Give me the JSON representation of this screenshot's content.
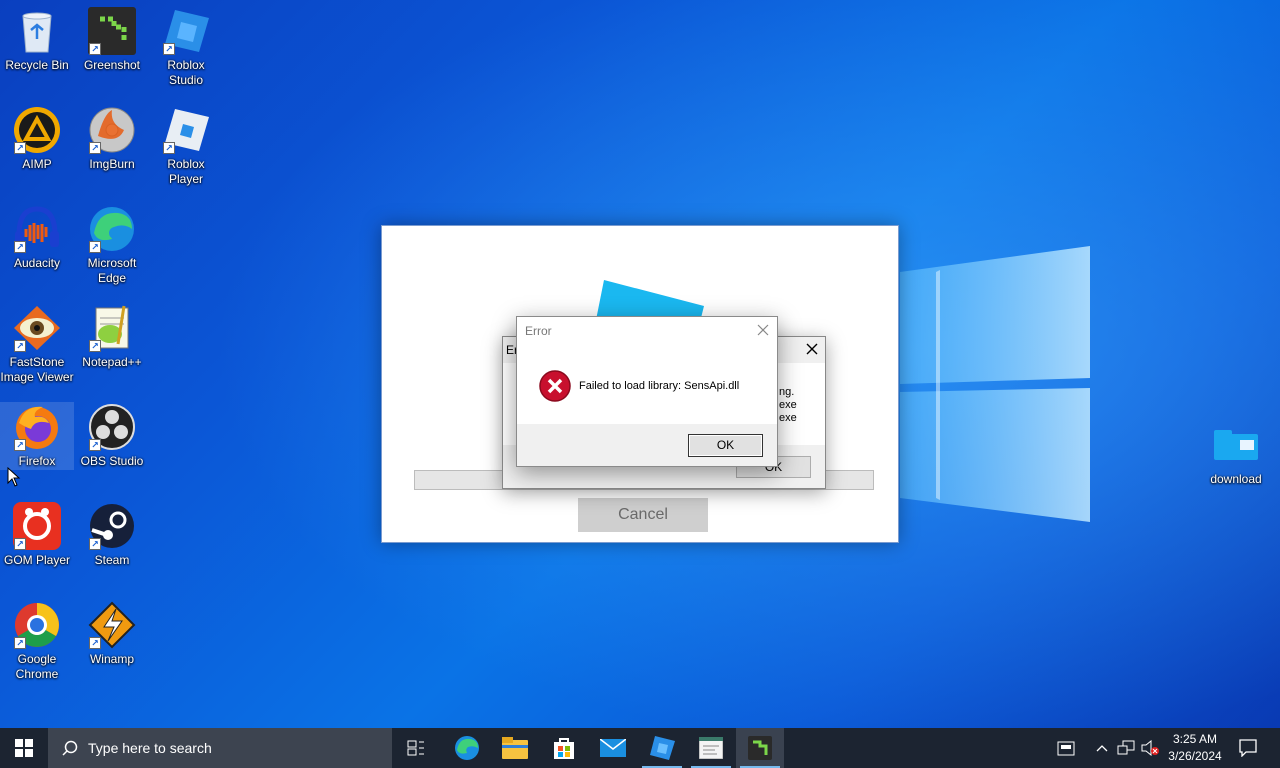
{
  "desktop": {
    "icons": [
      {
        "label": "Recycle Bin",
        "icon": "recycle-bin-icon"
      },
      {
        "label": "Greenshot",
        "icon": "greenshot-icon"
      },
      {
        "label": "Roblox Studio",
        "icon": "roblox-studio-icon"
      },
      {
        "label": "AIMP",
        "icon": "aimp-icon"
      },
      {
        "label": "ImgBurn",
        "icon": "imgburn-icon"
      },
      {
        "label": "Roblox Player",
        "icon": "roblox-player-icon"
      },
      {
        "label": "Audacity",
        "icon": "audacity-icon"
      },
      {
        "label": "Microsoft Edge",
        "icon": "edge-icon"
      },
      {
        "label": "FastStone Image Viewer",
        "icon": "faststone-icon"
      },
      {
        "label": "Notepad++",
        "icon": "notepadpp-icon"
      },
      {
        "label": "Firefox",
        "icon": "firefox-icon"
      },
      {
        "label": "OBS Studio",
        "icon": "obs-icon"
      },
      {
        "label": "GOM Player",
        "icon": "gom-player-icon"
      },
      {
        "label": "Steam",
        "icon": "steam-icon"
      },
      {
        "label": "Google Chrome",
        "icon": "chrome-icon"
      },
      {
        "label": "Winamp",
        "icon": "winamp-icon"
      },
      {
        "label": "download",
        "icon": "folder-icon"
      }
    ]
  },
  "background_window": {
    "cancel_label": "Cancel"
  },
  "error_dialog_back": {
    "title_fragment": "Er",
    "text_lines": [
      "ng.",
      "exe",
      "exe"
    ],
    "ok_label": "OK"
  },
  "error_dialog": {
    "title": "Error",
    "message": "Failed to load library: SensApi.dll",
    "ok_label": "OK"
  },
  "taskbar": {
    "search_placeholder": "Type here to search",
    "time": "3:25 AM",
    "date": "3/26/2024"
  },
  "colors": {
    "accent": "#0b6fe0",
    "taskbar": "#1c2431",
    "error_red": "#c8102e"
  }
}
